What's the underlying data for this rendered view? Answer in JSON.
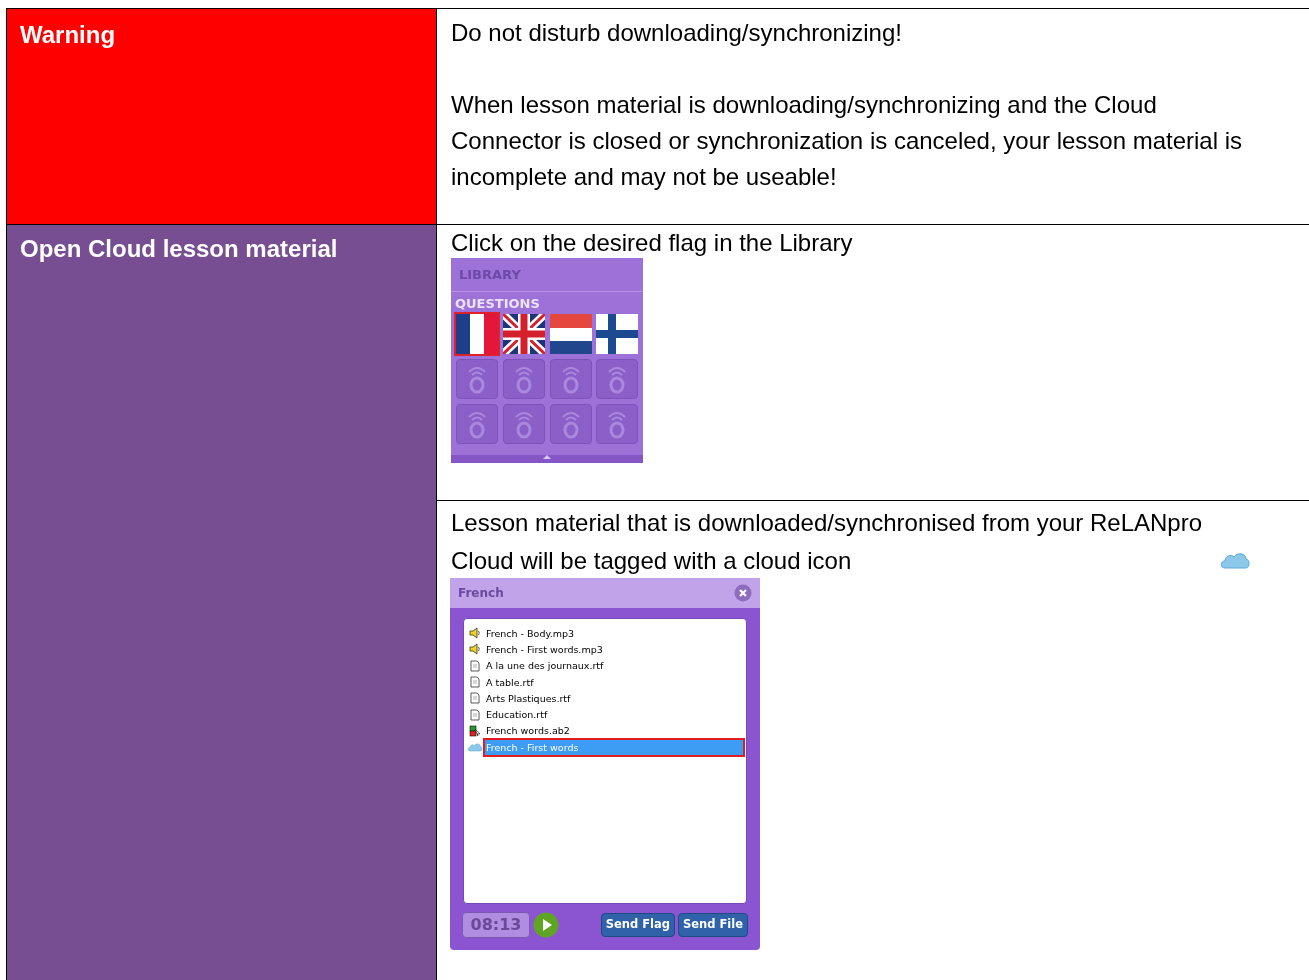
{
  "rows": [
    {
      "kind": "warning",
      "label": "Warning",
      "paragraphs": [
        "Do not disturb downloading/synchronizing!",
        "When lesson material is downloading/synchronizing and the Cloud Connector is closed or synchronization is canceled, your lesson material is incomplete and may not be useable!"
      ]
    },
    {
      "kind": "procedure",
      "label": "Open Cloud lesson material",
      "steps": [
        {
          "kind": "library",
          "text": "Click on the desired flag in the Library",
          "library": {
            "title": "LIBRARY",
            "section": "QUESTIONS",
            "flags": [
              {
                "kind": "france",
                "selected": true
              },
              {
                "kind": "uk",
                "selected": false
              },
              {
                "kind": "netherlands",
                "selected": false
              },
              {
                "kind": "finland",
                "selected": false
              }
            ]
          }
        },
        {
          "kind": "files",
          "text": "Lesson material that is downloaded/synchronised from your ReLANpro Cloud will be tagged with a cloud icon",
          "panel": {
            "title": "French",
            "items": [
              {
                "kind": "audio",
                "name": "French - Body.mp3",
                "selected": false
              },
              {
                "kind": "audio",
                "name": "French - First words.mp3",
                "selected": false
              },
              {
                "kind": "document",
                "name": "A la une des journaux.rtf",
                "selected": false
              },
              {
                "kind": "document",
                "name": "A table.rtf",
                "selected": false
              },
              {
                "kind": "document",
                "name": "Arts Plastiques.rtf",
                "selected": false
              },
              {
                "kind": "document",
                "name": "Education.rtf",
                "selected": false
              },
              {
                "kind": "flipchart",
                "name": "French words.ab2",
                "selected": false
              },
              {
                "kind": "cloud",
                "name": "French - First words",
                "selected": true
              }
            ],
            "timer": "08:13",
            "buttons": [
              "Send Flag",
              "Send File"
            ]
          }
        }
      ]
    }
  ]
}
